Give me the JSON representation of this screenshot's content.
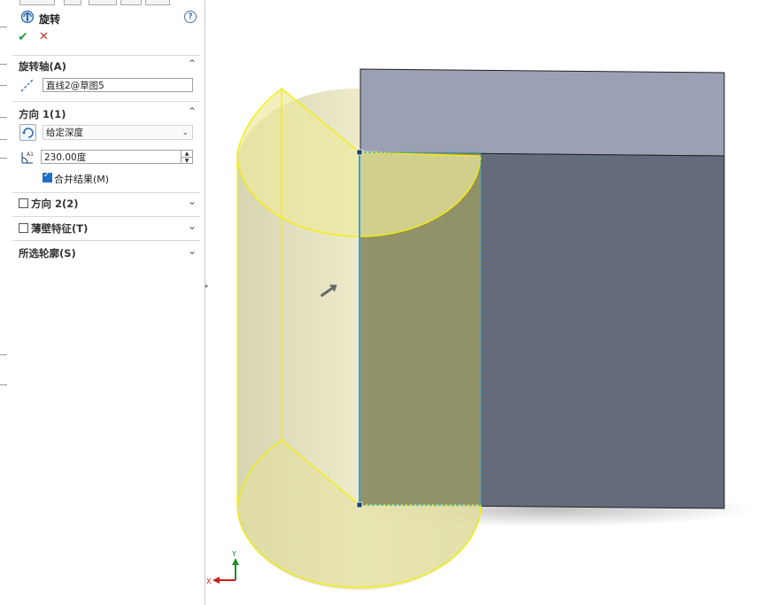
{
  "panel": {
    "title": "旋转",
    "help_glyph": "?",
    "ok_glyph": "✔",
    "cancel_glyph": "✕",
    "axis_section": {
      "label": "旋转轴(A)",
      "value": "直线2@草图5"
    },
    "dir1_section": {
      "label": "方向 1(1)",
      "end_condition": "给定深度",
      "angle": "230.00度",
      "merge_label": "合并结果(M)",
      "merge_checked": true
    },
    "dir2_section": {
      "label": "方向 2(2)",
      "checked": false
    },
    "thin_section": {
      "label": "薄壁特征(T)",
      "checked": false
    },
    "contours_section": {
      "label": "所选轮廓(S)"
    }
  },
  "colors": {
    "preview_fill": "#e6e29a",
    "preview_edge": "#f5ee00",
    "solid_top": "#9ba0b5",
    "solid_front": "#646b7a",
    "sketch_line": "#33a3e0"
  },
  "triad": {
    "x_label": "X",
    "y_label": "Y"
  }
}
